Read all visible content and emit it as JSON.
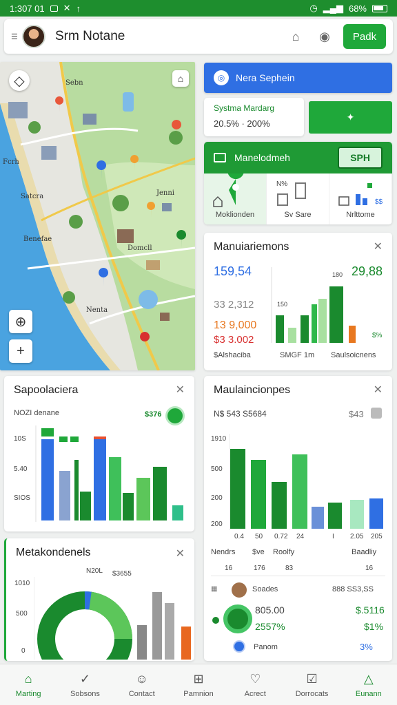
{
  "status_bar": {
    "time": "1:307 01",
    "battery": "68%"
  },
  "header": {
    "title": "Srm Notane",
    "action_label": "Padk"
  },
  "map": {
    "labels": [
      "Sebn",
      "Fcrh",
      "Jenni",
      "Satcra",
      "Benefae",
      "Domcll",
      "Nenta"
    ]
  },
  "search": {
    "label": "Nera Sephein"
  },
  "system_card": {
    "title": "Systma Mardarg",
    "range": "20.5% · 200%"
  },
  "management": {
    "title": "Manelodmeh",
    "badge": "SPH",
    "tabs": [
      {
        "label": "Moklionden",
        "caption": ""
      },
      {
        "label": "Sv Sare",
        "caption": "N%"
      },
      {
        "label": "Nrlttome",
        "caption": ""
      }
    ]
  },
  "panel_a": {
    "title": "Manuiariemons",
    "values": {
      "blue": "159,54",
      "right": "29,88",
      "gray": "33 2,312",
      "orange": "13 9,000",
      "red": "$3 3.002"
    },
    "axis": {
      "top": "180",
      "mid": "150"
    },
    "legend_val": "$%",
    "footer": [
      "$Alshaciba",
      "SMGF 1m",
      "Saulsoicnens"
    ]
  },
  "panel_b": {
    "title": "Sapoolaciera",
    "subtitle": "NOZI denane",
    "badge": "$376",
    "yticks": [
      "10S",
      "5.40",
      "SIOS"
    ]
  },
  "panel_c": {
    "title": "Maulaincionpes",
    "subtitle": "N$ 543 S5684",
    "right": "$43",
    "yticks": [
      "1910",
      "500",
      "200",
      "200"
    ],
    "xticks": [
      "0.4",
      "50",
      "0.72",
      "24",
      "I",
      "2.05",
      "205"
    ],
    "cols": [
      {
        "label": "Nendrs",
        "sub": "16"
      },
      {
        "label": "$ve",
        "sub": "176"
      },
      {
        "label": "Roolfy",
        "sub": "83"
      },
      {
        "label": "Baadliy",
        "sub": "16"
      }
    ],
    "rows": [
      {
        "label": "Soades",
        "value": "888 SS3,SS",
        "amount": "805.00",
        "delta": "$.5116"
      },
      {
        "label": "",
        "value": "",
        "amount": "2557%",
        "delta": "$1%"
      },
      {
        "label": "Panom",
        "value": "",
        "amount": "",
        "delta": "3%"
      }
    ]
  },
  "panel_d": {
    "title": "Metakondenels",
    "yticks": [
      "1010",
      "500",
      "0"
    ],
    "annot": [
      "N20L",
      "$3655"
    ]
  },
  "bottom_nav": [
    {
      "label": "Marting",
      "icon": "home-icon",
      "active": true
    },
    {
      "label": "Sobsons",
      "icon": "check-circle-icon",
      "active": false
    },
    {
      "label": "Contact",
      "icon": "person-icon",
      "active": false
    },
    {
      "label": "Pamnion",
      "icon": "grid-circle-icon",
      "active": false
    },
    {
      "label": "Acrect",
      "icon": "heart-icon",
      "active": false
    },
    {
      "label": "Dorrocats",
      "icon": "chart-icon",
      "active": false
    },
    {
      "label": "Eunann",
      "icon": "bell-icon",
      "active": true
    }
  ],
  "colors": {
    "primary_green": "#1fa83a",
    "dark_green": "#1a8a2e",
    "blue": "#2f6fe3"
  }
}
